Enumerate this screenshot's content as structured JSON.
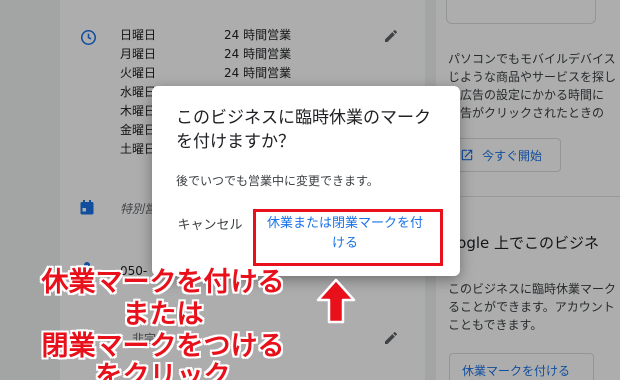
{
  "hours": [
    {
      "day": "日曜日",
      "time": "24 時間営業"
    },
    {
      "day": "月曜日",
      "time": "24 時間営業"
    },
    {
      "day": "火曜日",
      "time": "24 時間営業"
    },
    {
      "day": "水曜日",
      "time": ""
    },
    {
      "day": "木曜日",
      "time": ""
    },
    {
      "day": "金曜日",
      "time": ""
    },
    {
      "day": "土曜日",
      "time": ""
    }
  ],
  "special_hours_label": "特別営",
  "phone_partial": "050-",
  "other_partial": "非宗",
  "right_panel": {
    "para1_lines": [
      "パソコンでもモバイルデバイス",
      "じような商品やサービスを探し",
      "。広告の設定にかかる時間に",
      "広告がクリックされたときの"
    ],
    "start_label": "今すぐ開始",
    "heading": "oogle 上でこのビジネ",
    "para2_lines": [
      "このビジネスに臨時休業マーク",
      "ることができます。アカウント",
      "こともできます。"
    ],
    "closed_button_label": "休業マークを付ける"
  },
  "dialog": {
    "title": "このビジネスに臨時休業のマークを付けますか？",
    "body": "後でいつでも営業中に変更できます。",
    "cancel_label": "キャンセル",
    "confirm_label": "休業または閉業マークを付ける"
  },
  "annotation": {
    "line1": "休業マークを付ける",
    "line2": "または",
    "line3": "閉業マークをつける",
    "line4": "をクリック"
  },
  "colors": {
    "accent": "#1a73e8",
    "highlight": "#e8101a",
    "scrim": "rgba(0,0,0,0.32)"
  }
}
